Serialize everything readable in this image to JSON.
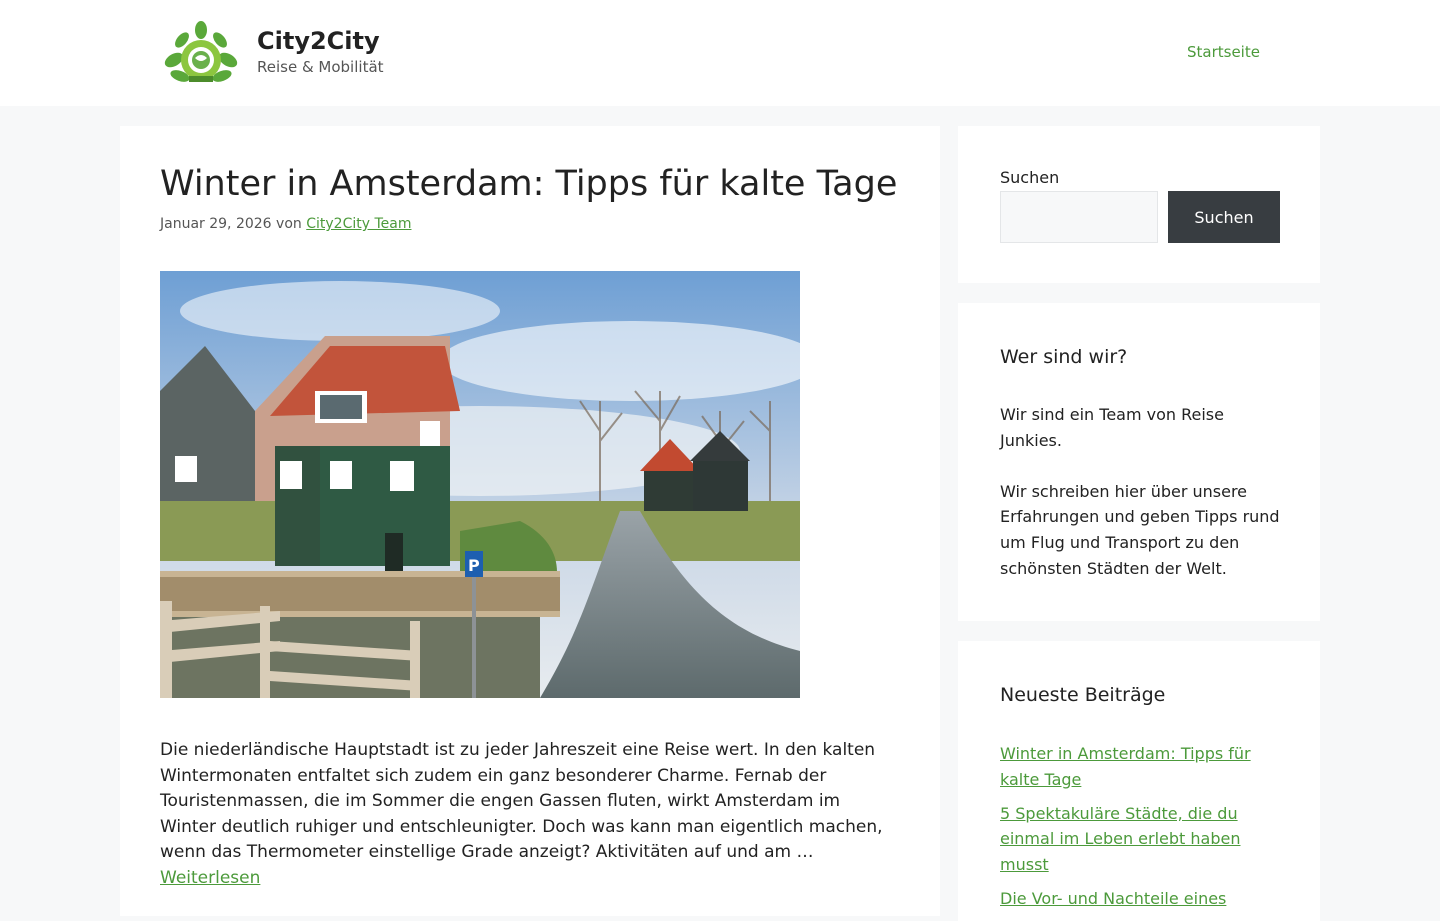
{
  "header": {
    "site_title": "City2City",
    "tagline": "Reise & Mobilität",
    "logo_icon": "globe-leaves-logo-icon",
    "nav": [
      {
        "label": "Startseite"
      }
    ]
  },
  "article": {
    "title": "Winter in Amsterdam: Tipps für kalte Tage",
    "date": "Januar 29, 2026",
    "by": "von",
    "author": "City2City Team",
    "image_icon": "canal-houses-photo",
    "excerpt": "Die niederländische Hauptstadt ist zu jeder Jahreszeit eine Reise wert. In den kalten Wintermonaten entfaltet sich zudem ein ganz besonderer Charme. Fernab der Touristenmassen, die im Sommer die engen Gassen fluten, wirkt Amsterdam im Winter deutlich ruhiger und entschleunigter. Doch was kann man eigentlich machen, wenn das Thermometer einstellige Grade anzeigt? Aktivitäten auf und am …",
    "read_more": "Weiterlesen"
  },
  "sidebar": {
    "search": {
      "label": "Suchen",
      "input_value": "",
      "button_label": "Suchen"
    },
    "about": {
      "title": "Wer sind wir?",
      "paragraphs": [
        "Wir sind ein Team von Reise Junkies.",
        "Wir schreiben hier über unsere Erfahrungen und geben Tipps rund um Flug und Transport zu den schönsten Städten der Welt."
      ]
    },
    "recent": {
      "title": "Neueste Beiträge",
      "items": [
        {
          "label": "Winter in Amsterdam: Tipps für kalte Tage"
        },
        {
          "label": "5 Spektakuläre Städte, die du einmal im Leben erlebt haben musst"
        },
        {
          "label": "Die Vor- und Nachteile eines"
        }
      ]
    }
  },
  "colors": {
    "accent": "#4c9a3b",
    "button_dark": "#383d41",
    "page_bg": "#f7f8f9"
  }
}
